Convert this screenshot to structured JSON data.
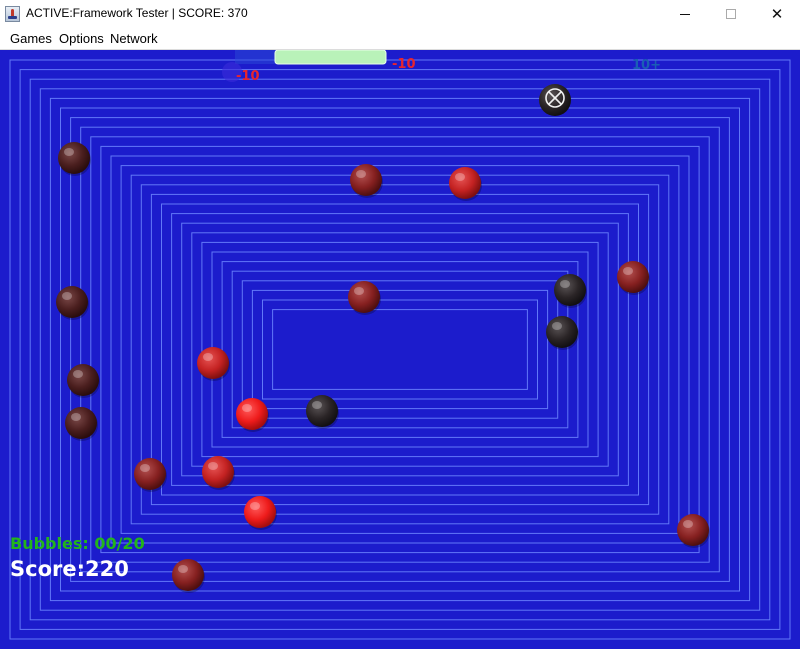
{
  "window": {
    "title": "ACTIVE:Framework Tester | SCORE: 370",
    "icon": "java-cup-icon",
    "controls": {
      "minimize": "minimize-icon",
      "maximize": "maximize-icon",
      "close": "✕"
    }
  },
  "menu": {
    "items": [
      "Games",
      "Options",
      "Network"
    ]
  },
  "game": {
    "background_color": "#1c1ccc",
    "line_color": "#6f88ff",
    "timer_fill_fraction": 0.75,
    "timer_color": "#b9f2b9",
    "floating_texts": [
      {
        "id": "penalty-1",
        "text": "-10",
        "color": "#e8252e"
      },
      {
        "id": "penalty-2",
        "text": "-10",
        "color": "#e8252e"
      },
      {
        "id": "bonus-1",
        "text": "10+",
        "color": "#1a5fb4"
      }
    ],
    "bubble_colors": {
      "bright_red": "#ef1f1f",
      "red": "#cc2222",
      "maroon": "#8c1f1f",
      "dark_brown": "#4a1e1e",
      "black": "#2a2426"
    },
    "cursor": "crosshair-ball-icon",
    "hud": {
      "bubbles_label": "Bubbles: 00/20",
      "bubbles_popped": 0,
      "bubbles_total": 20,
      "score_label": "Score:220",
      "score": 220
    }
  }
}
